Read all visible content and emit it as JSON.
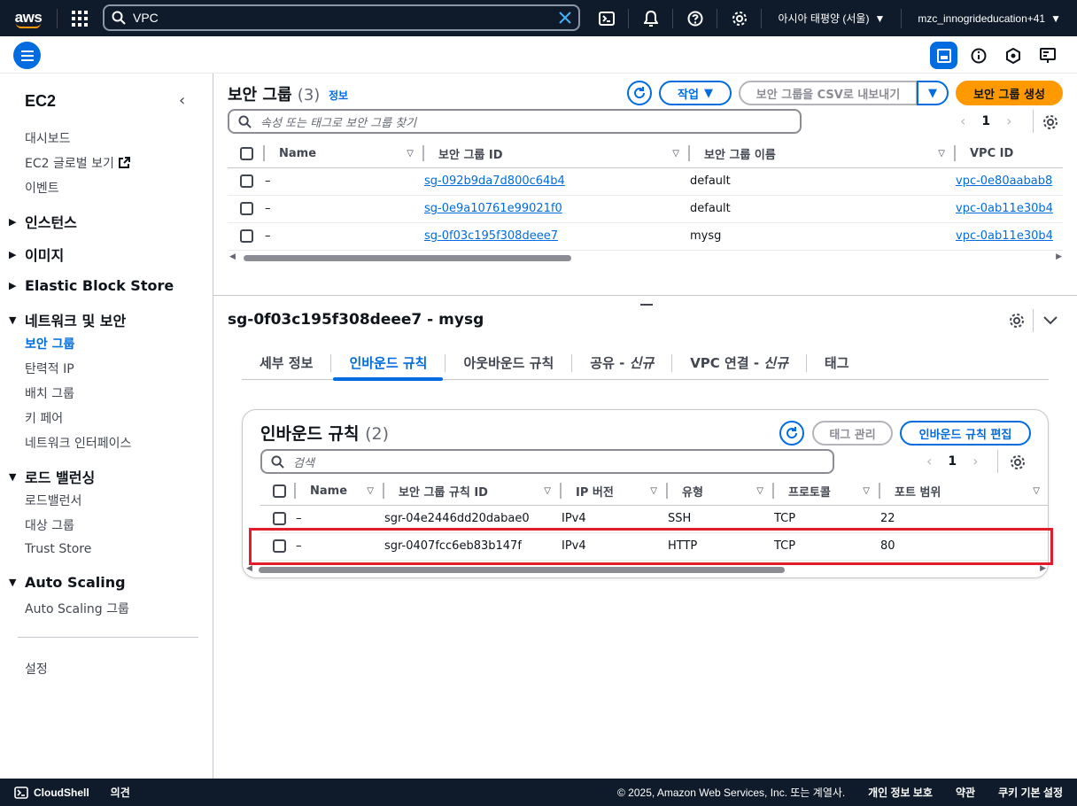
{
  "topnav": {
    "logo": "aws",
    "search_value": "VPC",
    "region": "아시아 태평양 (서울)",
    "account": "mzc_innogrideducation+41"
  },
  "sidebar": {
    "title": "EC2",
    "top_items": [
      "대시보드",
      "EC2 글로벌 보기",
      "이벤트"
    ],
    "sections": {
      "instances": "인스턴스",
      "images": "이미지",
      "ebs": "Elastic Block Store",
      "network": "네트워크 및 보안",
      "lb": "로드 밸런싱",
      "autoscaling": "Auto Scaling"
    },
    "network_items": [
      "보안 그룹",
      "탄력적 IP",
      "배치 그룹",
      "키 페어",
      "네트워크 인터페이스"
    ],
    "lb_items": [
      "로드밸런서",
      "대상 그룹",
      "Trust Store"
    ],
    "as_items": [
      "Auto Scaling 그룹"
    ],
    "settings": "설정"
  },
  "main": {
    "title": "보안 그룹",
    "count": "(3)",
    "info": "정보",
    "actions_button": "작업",
    "export_button": "보안 그룹을 CSV로 내보내기",
    "create_button": "보안 그룹 생성",
    "search_placeholder": "속성 또는 태그로 보안 그룹 찾기",
    "page": "1",
    "columns": [
      "Name",
      "보안 그룹 ID",
      "보안 그룹 이름",
      "VPC ID"
    ],
    "rows": [
      {
        "name": "–",
        "id": "sg-092b9da7d800c64b4",
        "group_name": "default",
        "vpc": "vpc-0e80aabab8"
      },
      {
        "name": "–",
        "id": "sg-0e9a10761e99021f0",
        "group_name": "default",
        "vpc": "vpc-0ab11e30b4"
      },
      {
        "name": "–",
        "id": "sg-0f03c195f308deee7",
        "group_name": "mysg",
        "vpc": "vpc-0ab11e30b4"
      }
    ]
  },
  "detail": {
    "title": "sg-0f03c195f308deee7 - mysg",
    "tabs": [
      {
        "label": "세부 정보",
        "suffix": ""
      },
      {
        "label": "인바운드 규칙",
        "suffix": ""
      },
      {
        "label": "아웃바운드 규칙",
        "suffix": ""
      },
      {
        "label": "공유 - ",
        "suffix": "신규"
      },
      {
        "label": "VPC 연결 - ",
        "suffix": "신규"
      },
      {
        "label": "태그",
        "suffix": ""
      }
    ],
    "active_tab": "인바운드 규칙"
  },
  "inbound": {
    "title": "인바운드 규칙",
    "count": "(2)",
    "manage_tags_button": "태그 관리",
    "edit_button": "인바운드 규칙 편집",
    "search_placeholder": "검색",
    "page": "1",
    "columns": [
      "Name",
      "보안 그룹 규칙 ID",
      "IP 버전",
      "유형",
      "프로토콜",
      "포트 범위"
    ],
    "rows": [
      {
        "name": "–",
        "rule_id": "sgr-04e2446dd20dabae0",
        "ip": "IPv4",
        "type": "SSH",
        "protocol": "TCP",
        "port": "22"
      },
      {
        "name": "–",
        "rule_id": "sgr-0407fcc6eb83b147f",
        "ip": "IPv4",
        "type": "HTTP",
        "protocol": "TCP",
        "port": "80"
      }
    ]
  },
  "footer": {
    "cloudshell": "CloudShell",
    "feedback": "의견",
    "copyright": "© 2025, Amazon Web Services, Inc. 또는 계열사.",
    "privacy": "개인 정보 보호",
    "terms": "약관",
    "cookies": "쿠키 기본 설정"
  },
  "colors": {
    "nav_bg": "#0f1b2a",
    "link": "#006ce0",
    "primary": "#ff9900",
    "highlight": "#e21b2d"
  }
}
